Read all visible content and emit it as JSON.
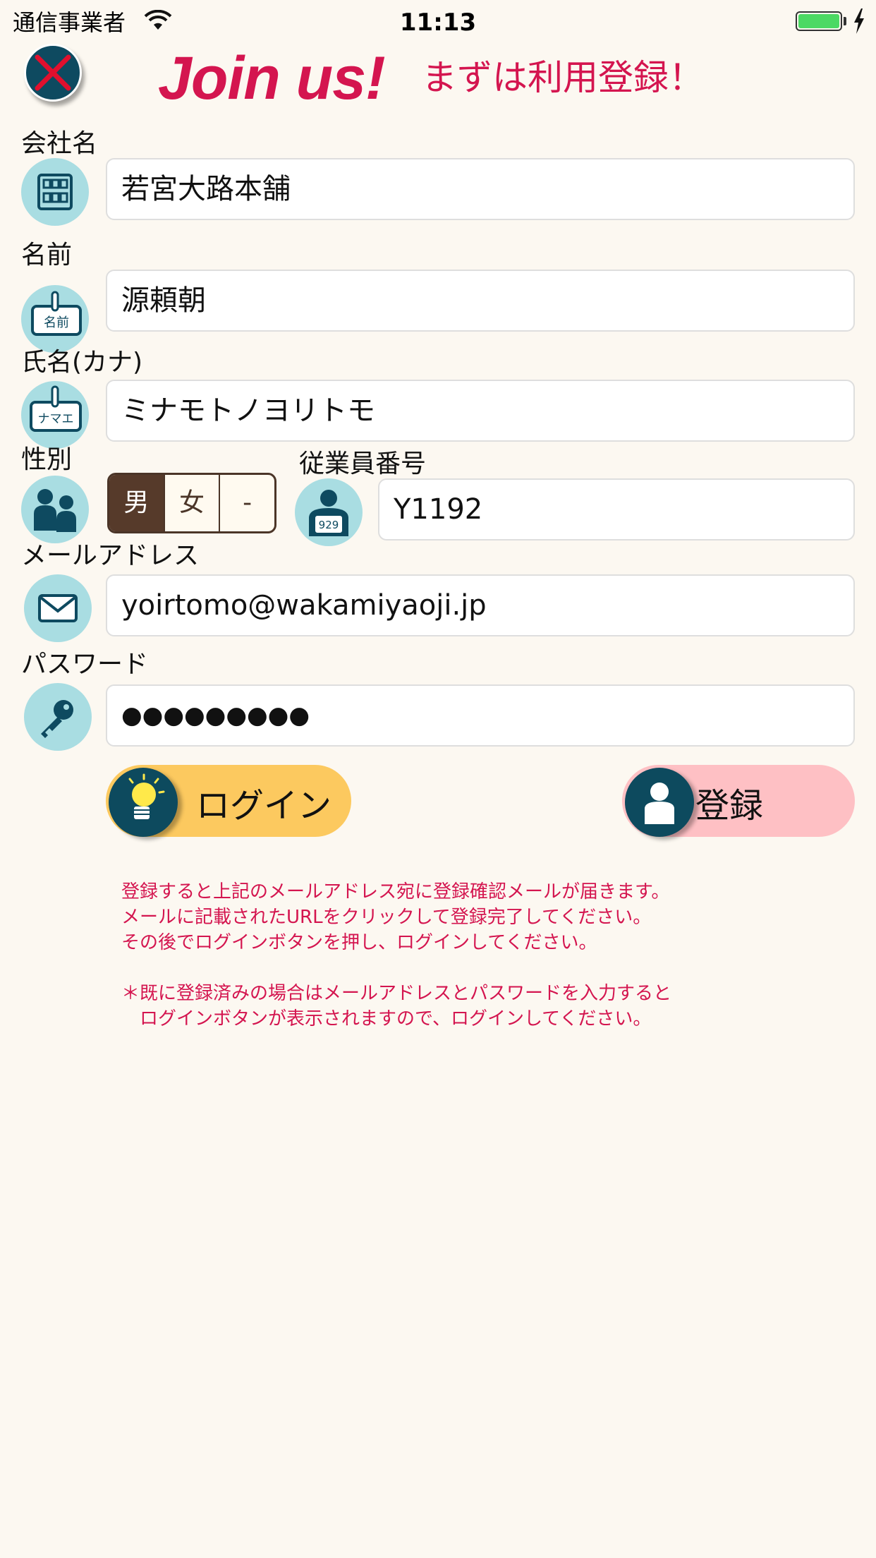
{
  "status_bar": {
    "carrier": "通信事業者",
    "time": "11:13"
  },
  "header": {
    "title": "Join us!",
    "subtitle": "まずは利用登録！"
  },
  "form": {
    "company": {
      "label": "会社名",
      "value": "若宮大路本舗",
      "icon": "building-icon"
    },
    "name": {
      "label": "名前",
      "value": "源頼朝",
      "icon": "name-tag-icon",
      "icon_text": "名前"
    },
    "kana": {
      "label": "氏名(カナ)",
      "value": "ミナモトノヨリトモ",
      "icon": "name-tag-kana-icon",
      "icon_text": "ナマエ"
    },
    "gender": {
      "label": "性別",
      "options": [
        "男",
        "女",
        "-"
      ],
      "selected": "男",
      "icon": "people-icon"
    },
    "employee_number": {
      "label": "従業員番号",
      "value": "Y1192",
      "icon": "employee-badge-icon",
      "icon_text": "929"
    },
    "email": {
      "label": "メールアドレス",
      "value": "yoirtomo@wakamiyaoji.jp",
      "icon": "envelope-icon"
    },
    "password": {
      "label": "パスワード",
      "value": "●●●●●●●●●",
      "icon": "key-icon"
    }
  },
  "buttons": {
    "login": "ログイン",
    "register": "登録"
  },
  "notice": {
    "line1": "登録すると上記のメールアドレス宛に登録確認メールが届きます。",
    "line2": "メールに記載されたURLをクリックして登録完了してください。",
    "line3": "その後でログインボタンを押し、ログインしてください。",
    "line4": "＊既に登録済みの場合はメールアドレスとパスワードを入力すると",
    "line5": "　ログインボタンが表示されますので、ログインしてください。"
  },
  "colors": {
    "accent": "#d4154f",
    "background": "#fcf8f1",
    "icon_bg": "#a9dde2",
    "icon_dark": "#0e4a60",
    "login_button": "#fcc95f",
    "register_button": "#fec0c4",
    "segment_selected": "#563a2a"
  }
}
